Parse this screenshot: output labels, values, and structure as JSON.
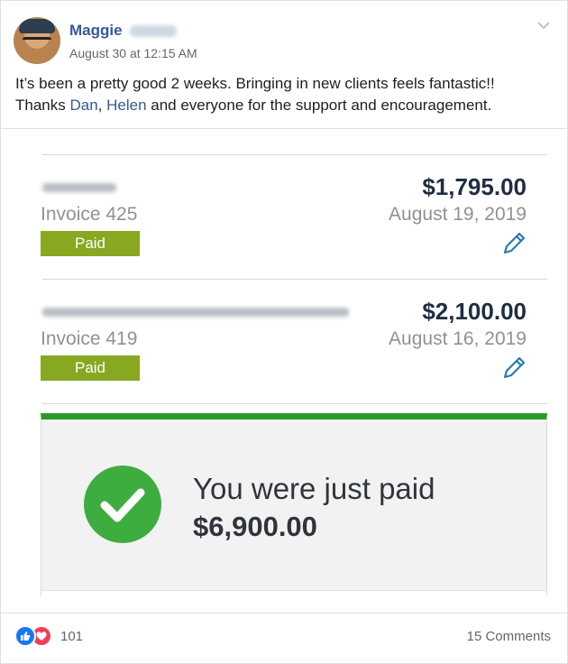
{
  "post": {
    "author": "Maggie",
    "timestamp": "August 30 at 12:15 AM",
    "text_line1": "It’s been a pretty good 2 weeks. Bringing in new clients feels fantastic!!",
    "text_line2_prefix": "Thanks ",
    "mention_1": "Dan",
    "text_sep": ", ",
    "mention_2": "Helen",
    "text_line2_suffix": " and everyone for the support and encouragement."
  },
  "invoices": [
    {
      "invoice_label": "Invoice 425",
      "status": "Paid",
      "amount": "$1,795.00",
      "date": "August 19, 2019"
    },
    {
      "invoice_label": "Invoice 419",
      "status": "Paid",
      "amount": "$2,100.00",
      "date": "August 16, 2019"
    }
  ],
  "payment_banner": {
    "message": "You were just paid",
    "total": "$6,900.00"
  },
  "footer": {
    "reaction_count": "101",
    "comments": "15 Comments"
  },
  "icons": {
    "like": "like-icon",
    "love": "love-icon",
    "edit": "pencil-icon",
    "check": "check-circle-icon",
    "menu": "chevron-down-icon"
  },
  "colors": {
    "link": "#385898",
    "paid_badge": "#88a822",
    "success": "#2b9b28",
    "check_circle": "#3dad3f"
  }
}
